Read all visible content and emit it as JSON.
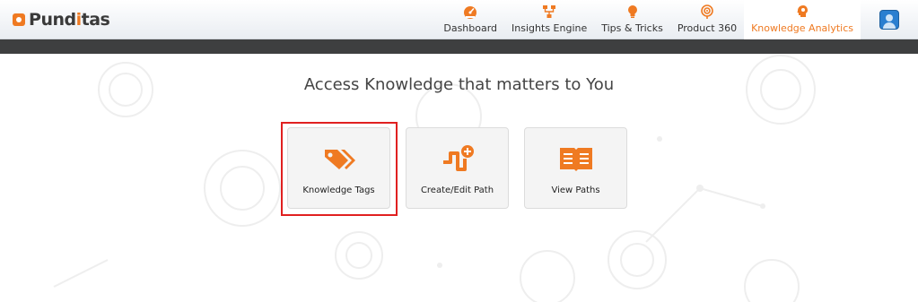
{
  "header": {
    "logo": {
      "text_a": "P",
      "text_b": "und",
      "text_c": "i",
      "text_d": "tas",
      "full": "Punditas"
    },
    "nav": [
      {
        "label": "Dashboard",
        "icon": "speedometer-icon"
      },
      {
        "label": "Insights Engine",
        "icon": "flowchart-icon"
      },
      {
        "label": "Tips & Tricks",
        "icon": "lightbulb-icon"
      },
      {
        "label": "Product 360",
        "icon": "target-icon"
      },
      {
        "label": "Knowledge Analytics",
        "icon": "brain-gear-icon",
        "active": true
      }
    ],
    "user": {
      "icon": "user-avatar-icon"
    }
  },
  "main": {
    "headline": "Access Knowledge that matters to You",
    "tiles": [
      {
        "label": "Knowledge Tags",
        "icon": "tags-icon"
      },
      {
        "label": "Create/Edit Path",
        "icon": "path-add-icon"
      },
      {
        "label": "View Paths",
        "icon": "open-book-icon"
      }
    ]
  },
  "colors": {
    "accent": "#ef7a22",
    "dark_bar": "#3e3f40",
    "highlight": "#e02020"
  }
}
